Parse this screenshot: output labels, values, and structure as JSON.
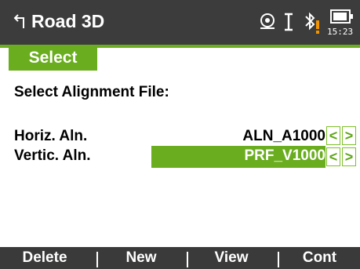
{
  "titlebar": {
    "title": "Road 3D",
    "time": "15:23"
  },
  "tab": {
    "label": "Select"
  },
  "form": {
    "heading": "Select Alignment File:",
    "rows": [
      {
        "label": "Horiz. Aln.",
        "value": "ALN_A1000"
      },
      {
        "label": "Vertic. Aln.",
        "value": "PRF_V1000"
      }
    ]
  },
  "softkeys": [
    "Delete",
    "New",
    "View",
    "Cont"
  ],
  "colors": {
    "accent": "#6aad1f",
    "titlebar": "#3c3c3c",
    "softkey_bar": "#3a3a3a"
  },
  "icons": [
    "back-arrow-icon",
    "gps-position-icon",
    "cursor-icon",
    "bluetooth-icon",
    "battery-icon",
    "warning-icon",
    "arrow-left-icon",
    "arrow-right-icon"
  ]
}
